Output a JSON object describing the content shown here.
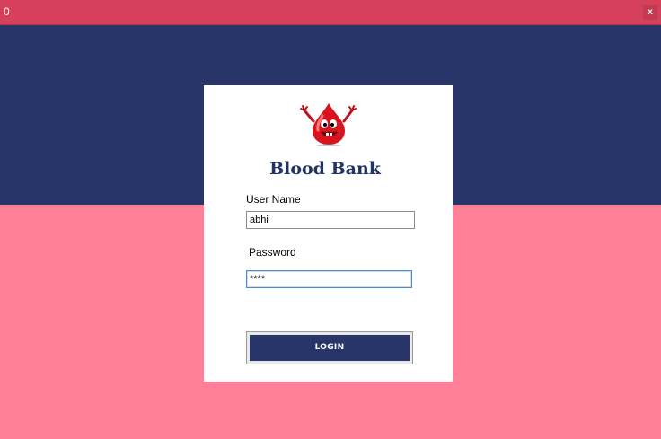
{
  "window": {
    "title": "0",
    "close_label": "x"
  },
  "app": {
    "title": "Blood Bank",
    "logo_icon": "blood-drop-mascot-icon"
  },
  "form": {
    "username_label": "User Name",
    "username_value": "abhi",
    "password_label": "Password",
    "password_value": "****",
    "login_label": "LOGIN"
  },
  "colors": {
    "titlebar": "#d6405a",
    "navy": "#283568",
    "pink": "#ff7f98",
    "card": "#ffffff",
    "title_text": "#1f3464"
  }
}
